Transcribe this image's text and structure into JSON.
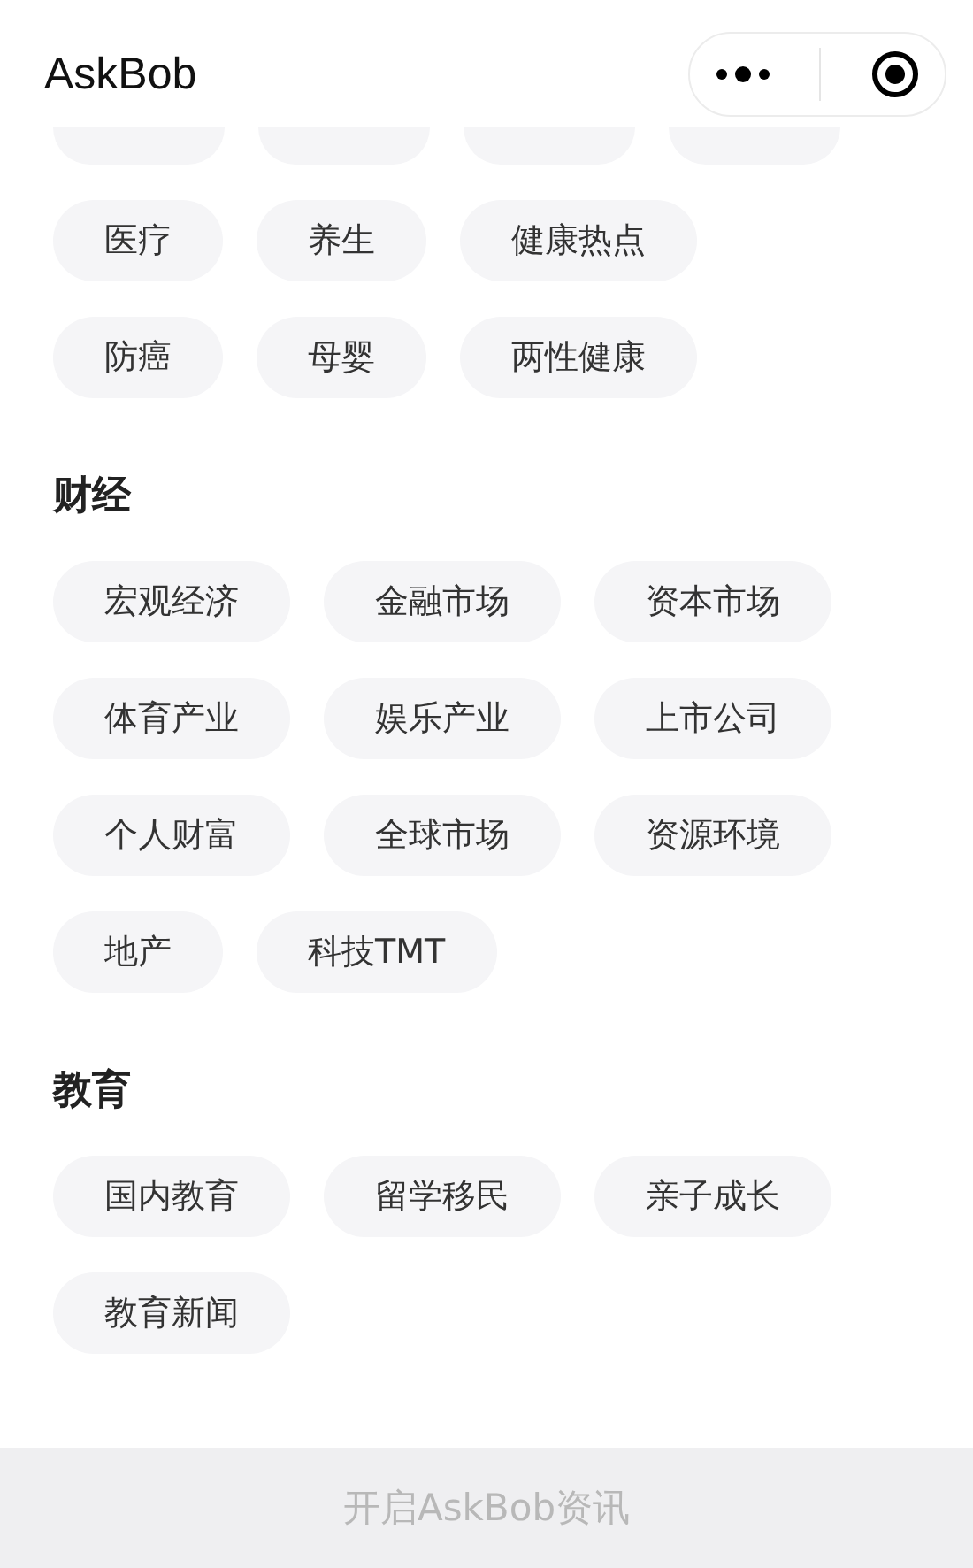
{
  "header": {
    "title": "AskBob"
  },
  "sections": [
    {
      "chips": [
        {
          "kind": "cut"
        },
        {
          "kind": "cut"
        },
        {
          "kind": "cut"
        },
        {
          "kind": "cut"
        },
        {
          "kind": "tag",
          "label": "医疗"
        },
        {
          "kind": "tag",
          "label": "养生"
        },
        {
          "kind": "tag",
          "label": "健康热点"
        },
        {
          "kind": "tag",
          "label": "防癌"
        },
        {
          "kind": "tag",
          "label": "母婴"
        },
        {
          "kind": "tag",
          "label": "两性健康"
        }
      ]
    },
    {
      "title": "财经",
      "chips": [
        {
          "kind": "tag",
          "label": "宏观经济"
        },
        {
          "kind": "tag",
          "label": "金融市场"
        },
        {
          "kind": "tag",
          "label": "资本市场"
        },
        {
          "kind": "tag",
          "label": "体育产业"
        },
        {
          "kind": "tag",
          "label": "娱乐产业"
        },
        {
          "kind": "tag",
          "label": "上市公司"
        },
        {
          "kind": "tag",
          "label": "个人财富"
        },
        {
          "kind": "tag",
          "label": "全球市场"
        },
        {
          "kind": "tag",
          "label": "资源环境"
        },
        {
          "kind": "tag",
          "label": "地产"
        },
        {
          "kind": "tag",
          "label": "科技TMT"
        }
      ]
    },
    {
      "title": "教育",
      "chips": [
        {
          "kind": "tag",
          "label": "国内教育"
        },
        {
          "kind": "tag",
          "label": "留学移民"
        },
        {
          "kind": "tag",
          "label": "亲子成长"
        },
        {
          "kind": "tag",
          "label": "教育新闻"
        }
      ]
    }
  ],
  "footer": {
    "button": "开启AskBob资讯"
  }
}
